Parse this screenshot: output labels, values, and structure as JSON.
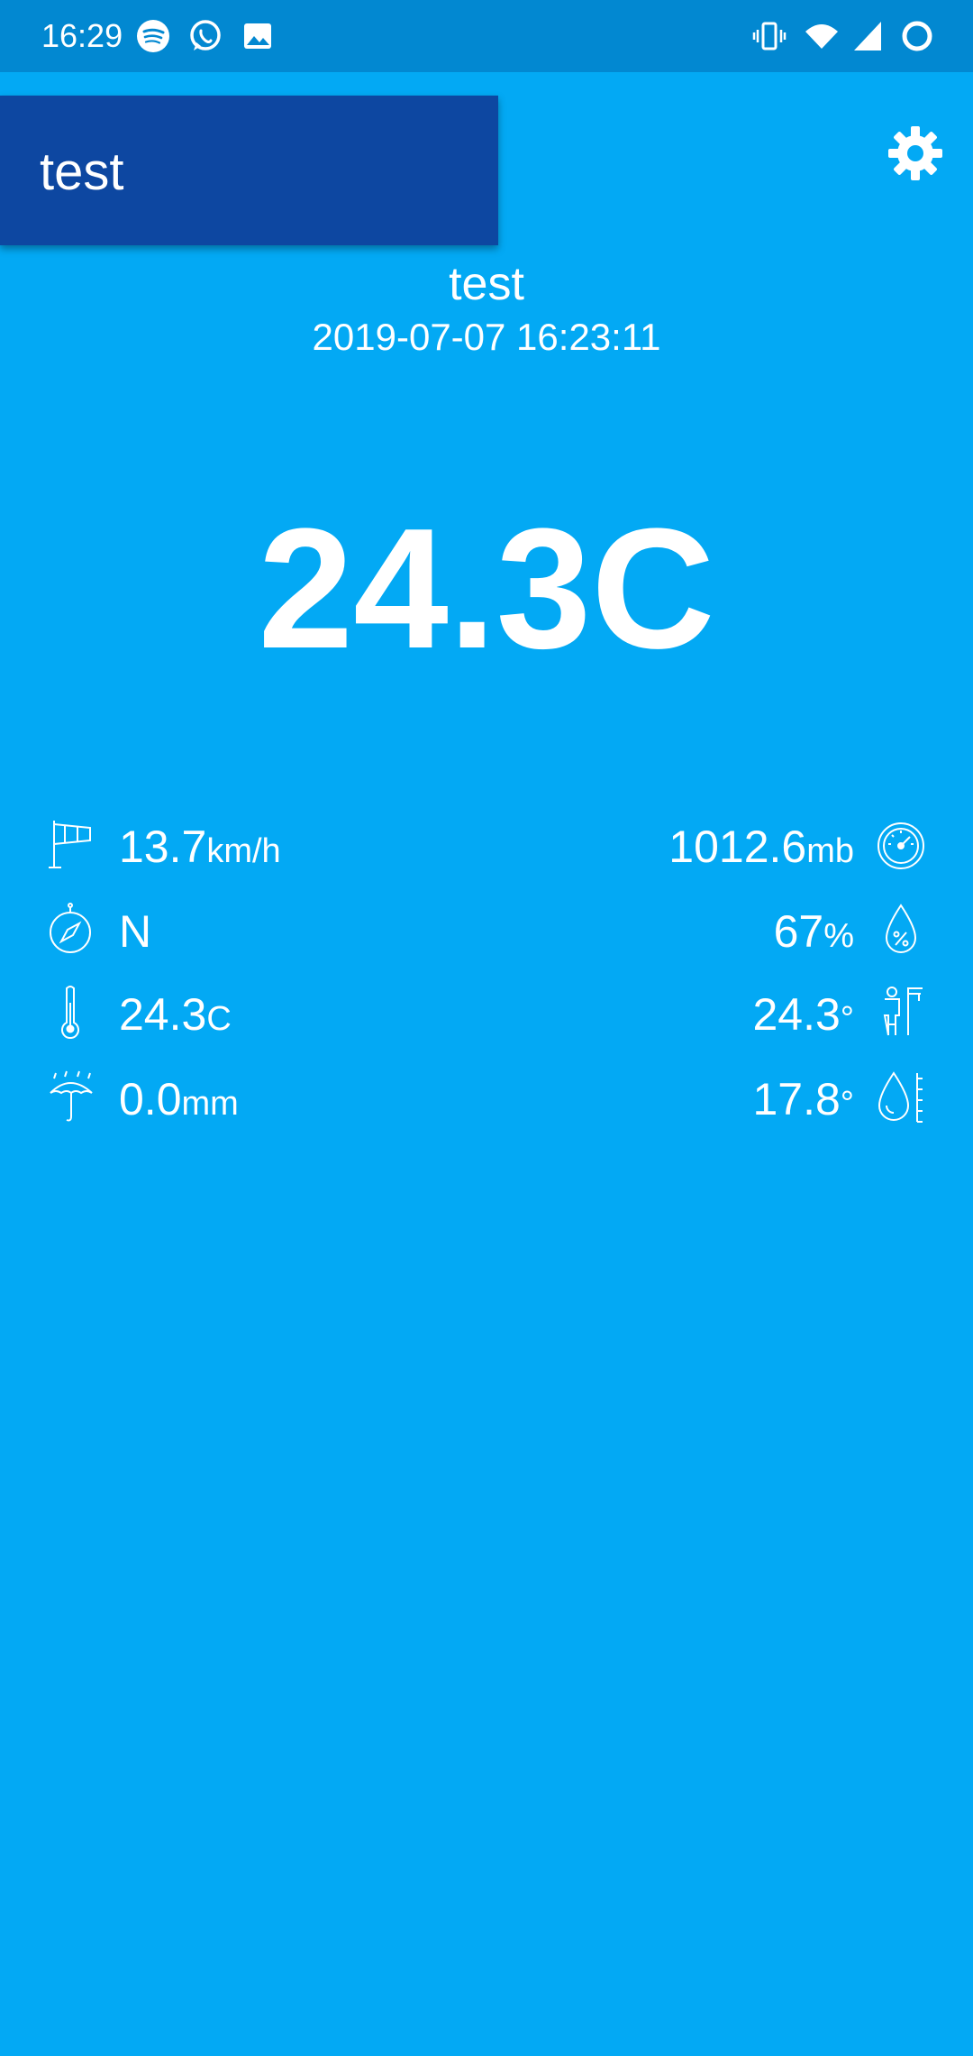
{
  "status_bar": {
    "time": "16:29",
    "left_icons": [
      "spotify-icon",
      "whatsapp-icon",
      "gallery-icon"
    ],
    "right_icons": [
      "vibrate-icon",
      "wifi-icon",
      "cell-signal-icon",
      "battery-icon"
    ]
  },
  "selector": {
    "label": "test"
  },
  "settings": {
    "icon": "gear-icon"
  },
  "station": {
    "name": "test",
    "timestamp": "2019-07-07 16:23:11"
  },
  "temperature": {
    "main": "24.3C"
  },
  "readings": {
    "wind_speed": {
      "value": "13.7",
      "unit": "km/h",
      "icon": "windsock-icon"
    },
    "wind_direction": {
      "value": "N",
      "unit": "",
      "icon": "compass-icon"
    },
    "temperature": {
      "value": "24.3",
      "unit": "C",
      "icon": "thermometer-icon"
    },
    "rain": {
      "value": "0.0",
      "unit": "mm",
      "icon": "umbrella-rain-icon"
    },
    "pressure": {
      "value": "1012.6",
      "unit": "mb",
      "icon": "barometer-icon"
    },
    "humidity": {
      "value": "67",
      "unit": "%",
      "icon": "humidity-drop-icon"
    },
    "feels_like": {
      "value": "24.3",
      "unit": "°",
      "icon": "feels-like-icon"
    },
    "dew_point": {
      "value": "17.8",
      "unit": "°",
      "icon": "dew-point-icon"
    }
  },
  "colors": {
    "background": "#03A9F4",
    "status_bar": "#0288D1",
    "selector": "#0D47A1",
    "text": "#FFFFFF"
  }
}
